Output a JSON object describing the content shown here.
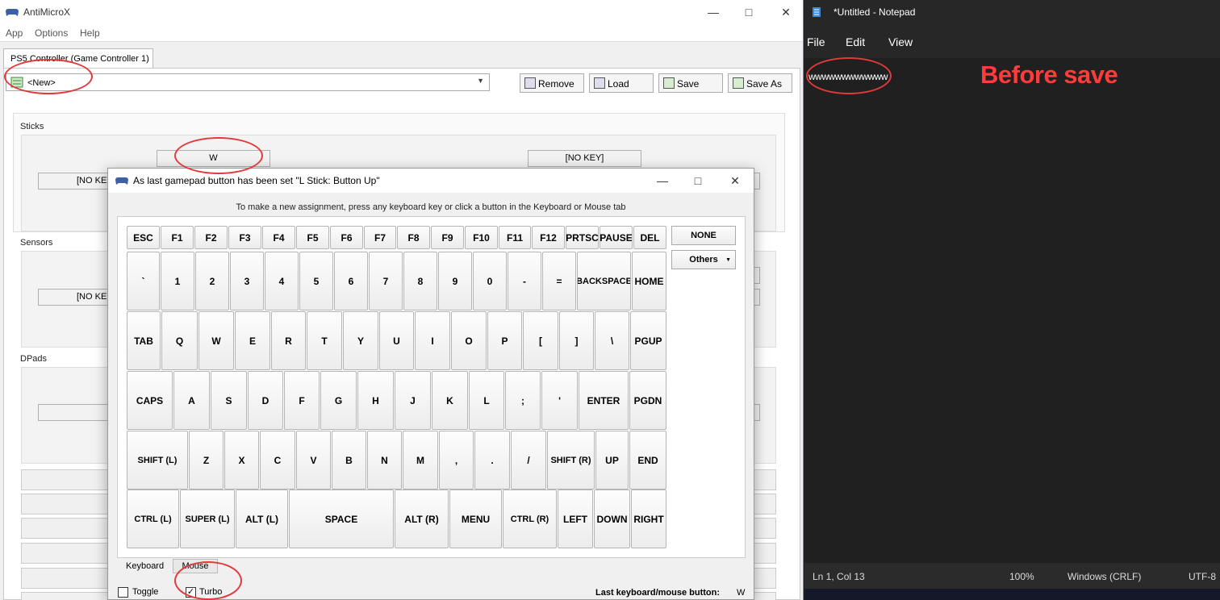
{
  "amx": {
    "title": "AntiMicroX",
    "menu": [
      "App",
      "Options",
      "Help"
    ],
    "tab": "PS5 Controller (Game Controller 1)",
    "profile": "<New>",
    "buttons": {
      "remove": "Remove",
      "load": "Load",
      "save": "Save",
      "save_as": "Save As"
    },
    "groups": {
      "sticks": "Sticks",
      "sensors": "Sensors",
      "dpads": "DPads"
    },
    "stick_up": "W",
    "no_key": "[NO KEY]",
    "no_key_partial": "[NO KEY"
  },
  "dialog": {
    "title": "As last gamepad button has been set \"L Stick: Button Up\"",
    "instruction": "To make a new assignment, press any keyboard key or click a button in the Keyboard or Mouse tab",
    "rows": [
      [
        "ESC",
        "F1",
        "F2",
        "F3",
        "F4",
        "F5",
        "F6",
        "F7",
        "F8",
        "F9",
        "F10",
        "F11",
        "F12",
        "PRTSC",
        "PAUSE",
        "DEL"
      ],
      [
        "`",
        "1",
        "2",
        "3",
        "4",
        "5",
        "6",
        "7",
        "8",
        "9",
        "0",
        "-",
        "=",
        "BACKSPACE",
        "HOME"
      ],
      [
        "TAB",
        "Q",
        "W",
        "E",
        "R",
        "T",
        "Y",
        "U",
        "I",
        "O",
        "P",
        "[",
        "]",
        "\\",
        "PGUP"
      ],
      [
        "CAPS",
        "A",
        "S",
        "D",
        "F",
        "G",
        "H",
        "J",
        "K",
        "L",
        ";",
        "'",
        "ENTER",
        "PGDN"
      ],
      [
        "SHIFT (L)",
        "Z",
        "X",
        "C",
        "V",
        "B",
        "N",
        "M",
        ",",
        ".",
        "/",
        "SHIFT (R)",
        "UP",
        "END"
      ],
      [
        "CTRL (L)",
        "SUPER (L)",
        "ALT (L)",
        "SPACE",
        "ALT (R)",
        "MENU",
        "CTRL (R)",
        "LEFT",
        "DOWN",
        "RIGHT"
      ]
    ],
    "none": "NONE",
    "others": "Others",
    "tabs": {
      "keyboard": "Keyboard",
      "mouse": "Mouse"
    },
    "toggle": "Toggle",
    "turbo": "Turbo",
    "turbo_checked": true,
    "toggle_checked": false,
    "last_label": "Last keyboard/mouse button:",
    "last_value": "W"
  },
  "notepad": {
    "title": "*Untitled - Notepad",
    "menu": [
      "File",
      "Edit",
      "View"
    ],
    "text": "wwwwwwwwwwww",
    "status": {
      "pos": "Ln 1, Col 13",
      "zoom": "100%",
      "eol": "Windows (CRLF)",
      "enc": "UTF-8"
    }
  },
  "annotation": "Before save",
  "colors": {
    "annotation": "#e23a3a",
    "notepad_bg": "#202020"
  }
}
